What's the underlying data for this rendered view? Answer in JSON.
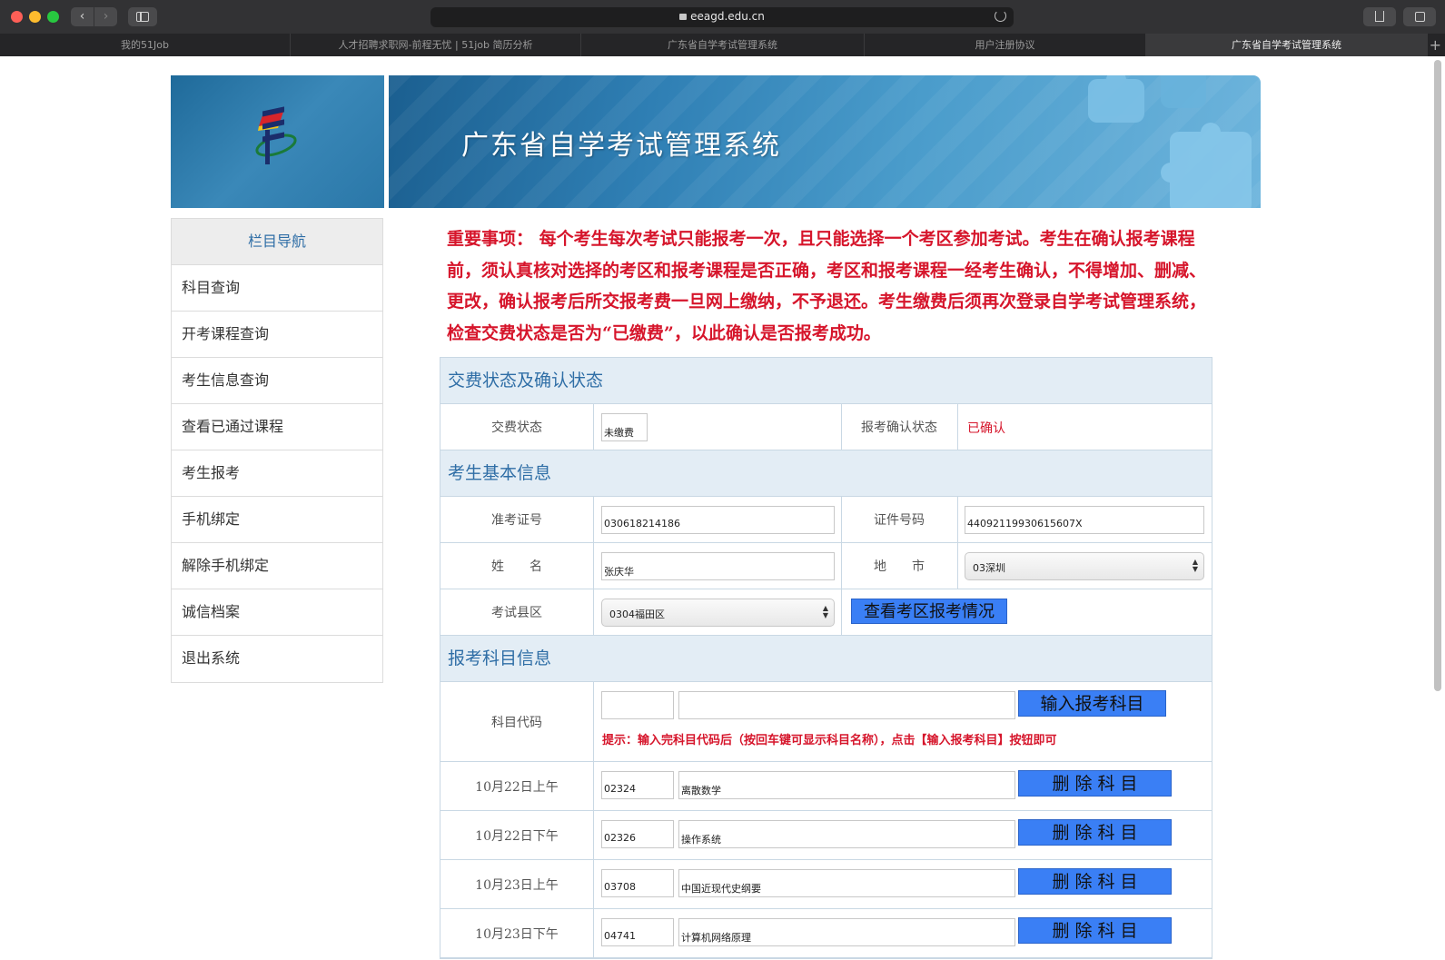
{
  "browser": {
    "url": "eeagd.edu.cn",
    "tabs": [
      {
        "label": "我的51Job"
      },
      {
        "label": "人才招聘求职网-前程无忧 | 51job 简历分析"
      },
      {
        "label": "广东省自学考试管理系统"
      },
      {
        "label": "用户注册协议"
      },
      {
        "label": "广东省自学考试管理系统"
      }
    ],
    "new_tab": "+"
  },
  "banner": {
    "title": "广东省自学考试管理系统"
  },
  "sidenav": {
    "heading": "栏目导航",
    "items": [
      {
        "label": "科目查询"
      },
      {
        "label": "开考课程查询"
      },
      {
        "label": "考生信息查询"
      },
      {
        "label": "查看已通过课程"
      },
      {
        "label": "考生报考"
      },
      {
        "label": "手机绑定"
      },
      {
        "label": "解除手机绑定"
      },
      {
        "label": "诚信档案"
      },
      {
        "label": "退出系统"
      }
    ]
  },
  "notice": {
    "text": "重要事项： 每个考生每次考试只能报考一次，且只能选择一个考区参加考试。考生在确认报考课程前，须认真核对选择的考区和报考课程是否正确，考区和报考课程一经考生确认，不得增加、删减、更改，确认报考后所交报考费一旦网上缴纳，不予退还。考生缴费后须再次登录自学考试管理系统，检查交费状态是否为“已缴费”，以此确认是否报考成功。"
  },
  "payment": {
    "section_title": "交费状态及确认状态",
    "fee_label": "交费状态",
    "fee_value": "未缴费",
    "confirm_label": "报考确认状态",
    "confirm_value": "已确认"
  },
  "basic": {
    "section_title": "考生基本信息",
    "admission_label": "准考证号",
    "admission_value": "030618214186",
    "id_label": "证件号码",
    "id_value": "44092119930615607X",
    "name_label": "姓　　名",
    "name_value": "张庆华",
    "city_label": "地　　市",
    "city_value": "03深圳",
    "district_label": "考试县区",
    "district_value": "0304福田区",
    "view_district_button": "查看考区报考情况"
  },
  "subjects": {
    "section_title": "报考科目信息",
    "code_label": "科目代码",
    "code_value": "",
    "name_value": "",
    "add_button": "输入报考科目",
    "hint": "提示：输入完科目代码后（按回车键可显示科目名称），点击【输入报考科目】按钮即可",
    "delete_button": "删 除 科 目",
    "rows": [
      {
        "time": "10月22日上午",
        "code": "02324",
        "name": "离散数学"
      },
      {
        "time": "10月22日下午",
        "code": "02326",
        "name": "操作系统"
      },
      {
        "time": "10月23日上午",
        "code": "03708",
        "name": "中国近现代史纲要"
      },
      {
        "time": "10月23日下午",
        "code": "04741",
        "name": "计算机网络原理"
      }
    ]
  },
  "colors": {
    "accent_blue": "#2f6ea6",
    "alert_red": "#d6152b",
    "button_blue": "#3a7ff5",
    "section_bg": "#e3edf5"
  }
}
